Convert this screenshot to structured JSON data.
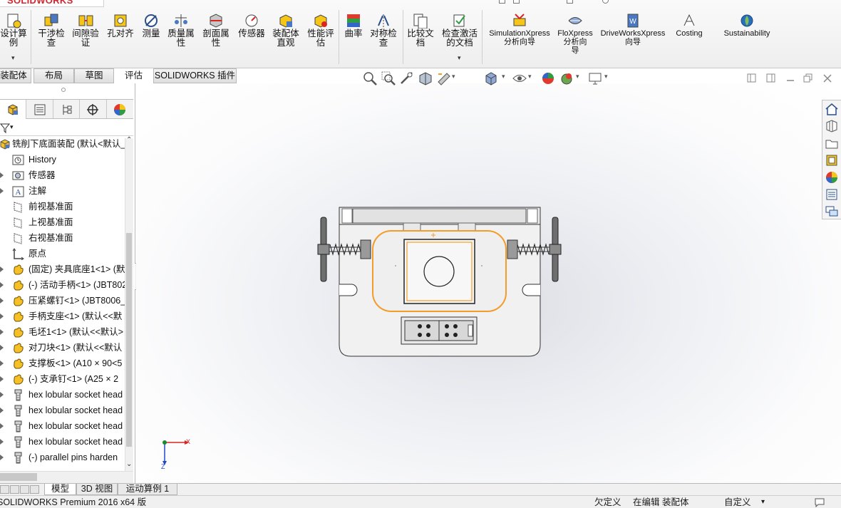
{
  "app": {
    "logo_text": "SOLIDWORKS",
    "brand_color": "#d22630",
    "selection_color": "#f39c29"
  },
  "ribbon": {
    "items": [
      {
        "label": "设计算\n例",
        "icon": "design-study-icon"
      },
      {
        "label": "干涉检\n查",
        "icon": "interference-icon"
      },
      {
        "label": "间隙验\n证",
        "icon": "clearance-icon"
      },
      {
        "label": "孔对齐",
        "icon": "hole-alignment-icon"
      },
      {
        "label": "测量",
        "icon": "measure-icon"
      },
      {
        "label": "质量属\n性",
        "icon": "mass-properties-icon"
      },
      {
        "label": "剖面属\n性",
        "icon": "section-properties-icon"
      },
      {
        "label": "传感器",
        "icon": "sensor-icon"
      },
      {
        "label": "装配体\n直观",
        "icon": "assemblyxpert-icon"
      },
      {
        "label": "性能评\n估",
        "icon": "performance-icon"
      },
      {
        "label": "曲率",
        "icon": "curvature-icon"
      },
      {
        "label": "对称检\n查",
        "icon": "symmetry-icon"
      },
      {
        "label": "比较文\n档",
        "icon": "compare-icon"
      },
      {
        "label": "检查激活\n的文档",
        "icon": "check-active-doc-icon"
      },
      {
        "label": "SimulationXpress\n分析向导",
        "icon": "simulationxpress-icon"
      },
      {
        "label": "FloXpress\n分析向\n导",
        "icon": "floxpress-icon"
      },
      {
        "label": "DriveWorksXpress\n向导",
        "icon": "driveworks-icon"
      },
      {
        "label": "Costing",
        "icon": "costing-icon"
      },
      {
        "label": "Sustainability",
        "icon": "sustainability-icon"
      }
    ],
    "dropdown_glyph": "▾"
  },
  "command_tabs": [
    "装配体",
    "布局",
    "草图",
    "评估",
    "SOLIDWORKS 插件"
  ],
  "command_tabs_active": "评估",
  "feature_tree": {
    "filter_glyph": "▾",
    "root": "铣削下底面装配  (默认<默认_",
    "items": [
      {
        "label": "History",
        "icon": "history-icon"
      },
      {
        "label": "传感器",
        "icon": "sensor-folder-icon"
      },
      {
        "label": "注解",
        "icon": "annotation-icon"
      },
      {
        "label": "前视基准面",
        "icon": "plane-icon"
      },
      {
        "label": "上视基准面",
        "icon": "plane-icon"
      },
      {
        "label": "右视基准面",
        "icon": "plane-icon"
      },
      {
        "label": "原点",
        "icon": "origin-icon"
      },
      {
        "label": "(固定) 夹具底座1<1> (默",
        "icon": "part-icon"
      },
      {
        "label": "(-) 活动手柄<1> (JBT802",
        "icon": "part-icon"
      },
      {
        "label": "压紧螺钉<1> (JBT8006_",
        "icon": "part-icon"
      },
      {
        "label": "手柄支座<1> (默认<<默",
        "icon": "part-icon"
      },
      {
        "label": "毛坯1<1> (默认<<默认>",
        "icon": "part-icon"
      },
      {
        "label": "对刀块<1> (默认<<默认",
        "icon": "part-icon"
      },
      {
        "label": "支撑板<1> (A10 × 90<5",
        "icon": "part-icon"
      },
      {
        "label": "(-) 支承钉<1> (A25 × 2",
        "icon": "part-icon"
      },
      {
        "label": "hex lobular socket head",
        "icon": "screw-icon"
      },
      {
        "label": "hex lobular socket head",
        "icon": "screw-icon"
      },
      {
        "label": "hex lobular socket head",
        "icon": "screw-icon"
      },
      {
        "label": "hex lobular socket head",
        "icon": "screw-icon"
      },
      {
        "label": "(-) parallel pins harden",
        "icon": "screw-icon"
      }
    ]
  },
  "triad": {
    "x_label": "X",
    "z_label": "Z"
  },
  "bottom_tabs": [
    "模型",
    "3D 视图",
    "运动算例 1"
  ],
  "bottom_tabs_active": "模型",
  "status": {
    "product": "SOLIDWORKS Premium 2016 x64 版",
    "state": "欠定义",
    "mode": "在编辑 装配体",
    "units": "自定义"
  }
}
